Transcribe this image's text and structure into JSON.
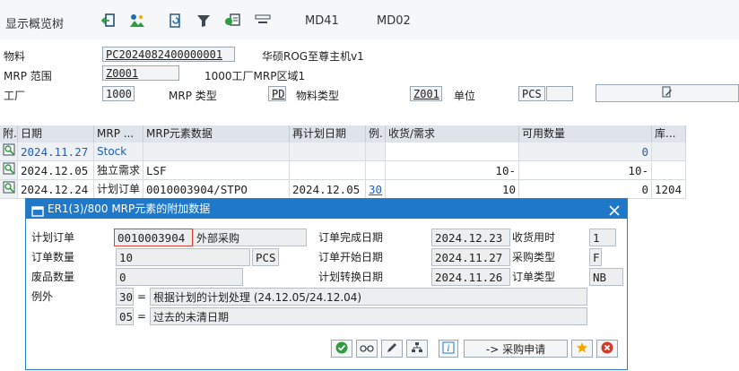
{
  "toolbar": {
    "title": "显示概览树",
    "icons": [
      "back-icon",
      "tree-icon",
      "refresh-icon",
      "filter-icon",
      "settings-icon",
      "layout-icon"
    ],
    "btn_md41": "MD41",
    "btn_md02": "MD02"
  },
  "header": {
    "material_label": "物料",
    "material_value": "PC2024082400000001",
    "material_desc": "华硕ROG至尊主机v1",
    "mrp_area_label": "MRP 范围",
    "mrp_area_value": "Z0001",
    "mrp_area_desc": "1000工厂MRP区域1",
    "plant_label": "工厂",
    "plant_value": "1000",
    "mrp_type_label": "MRP 类型",
    "mrp_type_value": "PD",
    "mat_type_label": "物料类型",
    "mat_type_value": "Z001",
    "unit_label": "单位",
    "unit_value": "PCS"
  },
  "grid": {
    "headers": {
      "att": "附.",
      "date": "日期",
      "mrp": "MRP ...",
      "mrpdata": "MRP元素数据",
      "reschedule": "再计划日期",
      "ex": "例.",
      "recreq": "收货/需求",
      "avail": "可用数量",
      "store": "库..."
    },
    "rows": [
      {
        "date": "2024.11.27",
        "mrp": "Stock",
        "mrpdata": "",
        "reschedule": "",
        "ex": "",
        "recreq": "",
        "avail": "0",
        "store": ""
      },
      {
        "date": "2024.12.05",
        "mrp": "独立需求",
        "mrpdata": "LSF",
        "reschedule": "",
        "ex": "",
        "recreq": "10-",
        "avail": "10-",
        "store": ""
      },
      {
        "date": "2024.12.24",
        "mrp": "计划订单",
        "mrpdata": "0010003904/STPO",
        "reschedule": "2024.12.05",
        "ex": "30",
        "recreq": "10",
        "avail": "0",
        "store": "1204"
      }
    ]
  },
  "dialog": {
    "title": "ER1(3)/800 MRP元素的附加数据",
    "planned_order_label": "计划订单",
    "planned_order_value": "0010003904",
    "procurement_desc": "外部采购",
    "order_qty_label": "订单数量",
    "order_qty_value": "10",
    "order_qty_unit": "PCS",
    "scrap_label": "废品数量",
    "scrap_value": "0",
    "exception_label": "例外",
    "exc1_code": "30",
    "exc1_eq": "=",
    "exc1_text": "根据计划的计划处理 (24.12.05/24.12.04)",
    "exc2_code": "05",
    "exc2_eq": "=",
    "exc2_text": "过去的未清日期",
    "finish_date_label": "订单完成日期",
    "finish_date_value": "2024.12.23",
    "gr_time_label": "收货用时",
    "gr_time_value": "1",
    "start_date_label": "订单开始日期",
    "start_date_value": "2024.11.27",
    "proc_type_label": "采购类型",
    "proc_type_value": "F",
    "conv_date_label": "计划转换日期",
    "conv_date_value": "2024.11.26",
    "order_type_label": "订单类型",
    "order_type_value": "NB",
    "purchase_req_btn": "-> 采购申请"
  },
  "colors": {
    "accent": "#1f78c8",
    "header_bg": "#dfe4ea",
    "ok_green": "#2e9b3e",
    "cancel_red": "#d23a2a",
    "star": "#f2a900"
  }
}
